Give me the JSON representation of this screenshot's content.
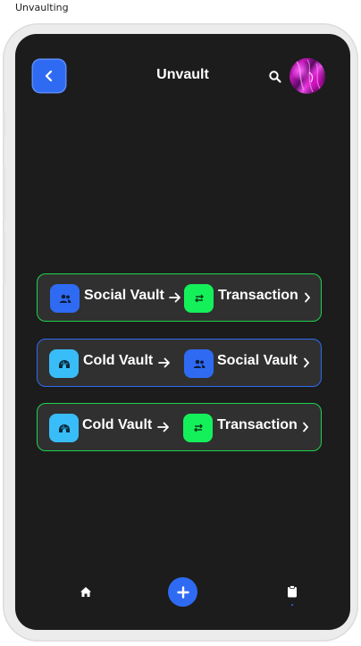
{
  "window": {
    "label": "Unvaulting"
  },
  "header": {
    "title": "Unvault",
    "back_icon": "chevron-left-icon",
    "search_icon": "search-icon",
    "avatar": "user-avatar"
  },
  "colors": {
    "accent_blue": "#2f6bf2",
    "accent_green": "#14f05a",
    "accent_cyan": "#38bdf8",
    "background": "#1c1c1c",
    "card": "#303030"
  },
  "routes": [
    {
      "from": "Social Vault",
      "to": "Transaction",
      "from_icon": "users-icon",
      "to_icon": "swap-icon",
      "border": "green"
    },
    {
      "from": "Cold Vault",
      "to": "Social Vault",
      "from_icon": "igloo-icon",
      "to_icon": "users-icon",
      "border": "blue"
    },
    {
      "from": "Cold Vault",
      "to": "Transaction",
      "from_icon": "igloo-icon",
      "to_icon": "swap-icon",
      "border": "green"
    }
  ],
  "bottom_nav": {
    "home_icon": "home-icon",
    "add_icon": "plus-icon",
    "clipboard_icon": "clipboard-icon"
  }
}
